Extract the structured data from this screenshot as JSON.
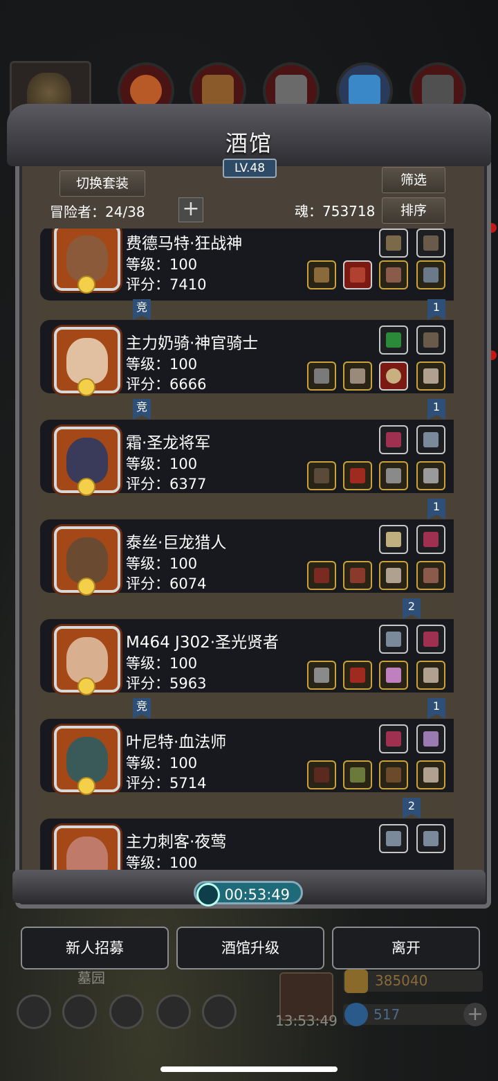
{
  "header": {
    "title": "酒馆",
    "level": "LV.48",
    "switch_outfit": "切换套装",
    "filter": "筛选",
    "sort": "排序",
    "adventurers": "冒险者：24/38",
    "soul": "魂：753718",
    "add": "+"
  },
  "heroes": [
    {
      "name": "费德马特·狂战神",
      "level": "等级：100",
      "score": "评分：7410",
      "tag": "1",
      "rank": "竞"
    },
    {
      "name": "主力奶骑·神官骑士",
      "level": "等级：100",
      "score": "评分：6666",
      "tag": "1",
      "rank": "竞"
    },
    {
      "name": "霜·圣龙将军",
      "level": "等级：100",
      "score": "评分：6377",
      "tag": "1",
      "rank": ""
    },
    {
      "name": "泰丝·巨龙猎人",
      "level": "等级：100",
      "score": "评分：6074",
      "tag": "2",
      "rank": ""
    },
    {
      "name": "M464 J302·圣光贤者",
      "level": "等级：100",
      "score": "评分：5963",
      "tag": "1",
      "rank": "竞"
    },
    {
      "name": "叶尼特·血法师",
      "level": "等级：100",
      "score": "评分：5714",
      "tag": "2",
      "rank": ""
    },
    {
      "name": "主力刺客·夜莺",
      "level": "等级：100",
      "score": "",
      "tag": "",
      "rank": ""
    }
  ],
  "timer": "00:53:49",
  "actions": {
    "recruit": "新人招募",
    "upgrade": "酒馆升级",
    "leave": "离开"
  },
  "background": {
    "area": "墓园",
    "clock": "13:53:49",
    "gold": "385040",
    "gems": "517"
  },
  "colors": {
    "accent": "#caa43a",
    "tag": "#2d4f78",
    "timer": "#1f6a78"
  }
}
